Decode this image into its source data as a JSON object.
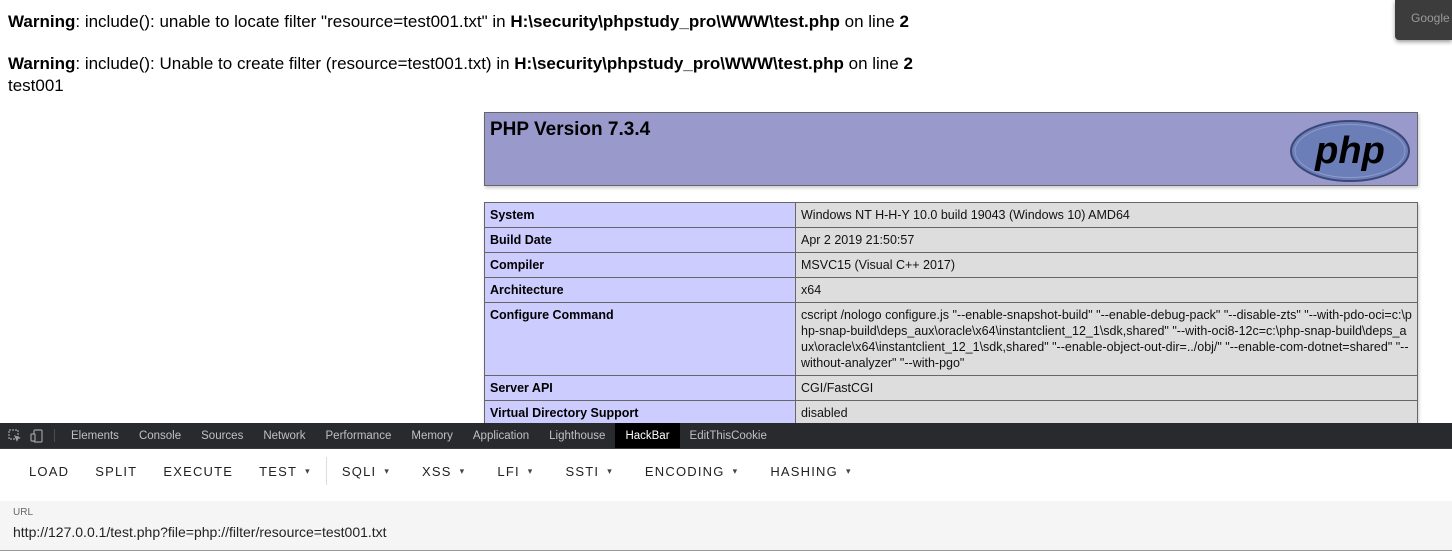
{
  "page": {
    "warnings": [
      {
        "label": "Warning",
        "text_a": ": include(): unable to locate filter \"resource=test001.txt\" in ",
        "file": "H:\\security\\phpstudy_pro\\WWW\\test.php",
        "text_b": " on line ",
        "line": "2"
      },
      {
        "label": "Warning",
        "text_a": ": include(): Unable to create filter (resource=test001.txt) in ",
        "file": "H:\\security\\phpstudy_pro\\WWW\\test.php",
        "text_b": " on line ",
        "line": "2"
      }
    ],
    "echo_output": "test001",
    "google_chip": "Google"
  },
  "phpinfo": {
    "version_title": "PHP Version 7.3.4",
    "logo_text": "php",
    "rows": [
      {
        "key": "System",
        "value": "Windows NT H-H-Y 10.0 build 19043 (Windows 10) AMD64"
      },
      {
        "key": "Build Date",
        "value": "Apr 2 2019 21:50:57"
      },
      {
        "key": "Compiler",
        "value": "MSVC15 (Visual C++ 2017)"
      },
      {
        "key": "Architecture",
        "value": "x64"
      },
      {
        "key": "Configure Command",
        "value": "cscript /nologo configure.js \"--enable-snapshot-build\" \"--enable-debug-pack\" \"--disable-zts\" \"--with-pdo-oci=c:\\php-snap-build\\deps_aux\\oracle\\x64\\instantclient_12_1\\sdk,shared\" \"--with-oci8-12c=c:\\php-snap-build\\deps_aux\\oracle\\x64\\instantclient_12_1\\sdk,shared\" \"--enable-object-out-dir=../obj/\" \"--enable-com-dotnet=shared\" \"--without-analyzer\" \"--with-pgo\""
      },
      {
        "key": "Server API",
        "value": "CGI/FastCGI"
      },
      {
        "key": "Virtual Directory Support",
        "value": "disabled"
      }
    ]
  },
  "devtools": {
    "tabs": [
      "Elements",
      "Console",
      "Sources",
      "Network",
      "Performance",
      "Memory",
      "Application",
      "Lighthouse",
      "HackBar",
      "EditThisCookie"
    ],
    "active_tab": "HackBar",
    "icons": [
      "inspect-element-icon",
      "device-toolbar-icon"
    ]
  },
  "hackbar": {
    "buttons": [
      "LOAD",
      "SPLIT",
      "EXECUTE",
      "TEST"
    ],
    "menus": [
      "SQLI",
      "XSS",
      "LFI",
      "SSTI",
      "ENCODING",
      "HASHING"
    ],
    "url_label": "URL",
    "url_value": "http://127.0.0.1/test.php?file=php://filter/resource=test001.txt"
  },
  "colors": {
    "php_header": "#9999cc",
    "php_key_cell": "#ccccff",
    "php_value_cell": "#dddddd",
    "devtools_bar": "#292a2d"
  }
}
